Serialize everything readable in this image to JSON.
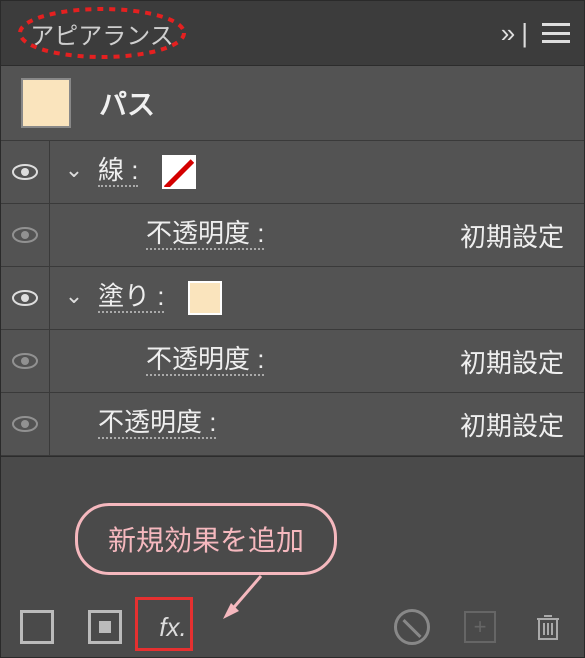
{
  "panel": {
    "title": "アピアランス"
  },
  "header": {
    "collapse": "»"
  },
  "object": {
    "label": "パス"
  },
  "rows": {
    "stroke": {
      "label": "線 :"
    },
    "stroke_opacity": {
      "label": "不透明度 :",
      "value": "初期設定"
    },
    "fill": {
      "label": "塗り :"
    },
    "fill_opacity": {
      "label": "不透明度 :",
      "value": "初期設定"
    },
    "opacity": {
      "label": "不透明度 :",
      "value": "初期設定"
    }
  },
  "footer": {
    "fx": "fx."
  },
  "annotation": {
    "balloon": "新規効果を追加"
  }
}
